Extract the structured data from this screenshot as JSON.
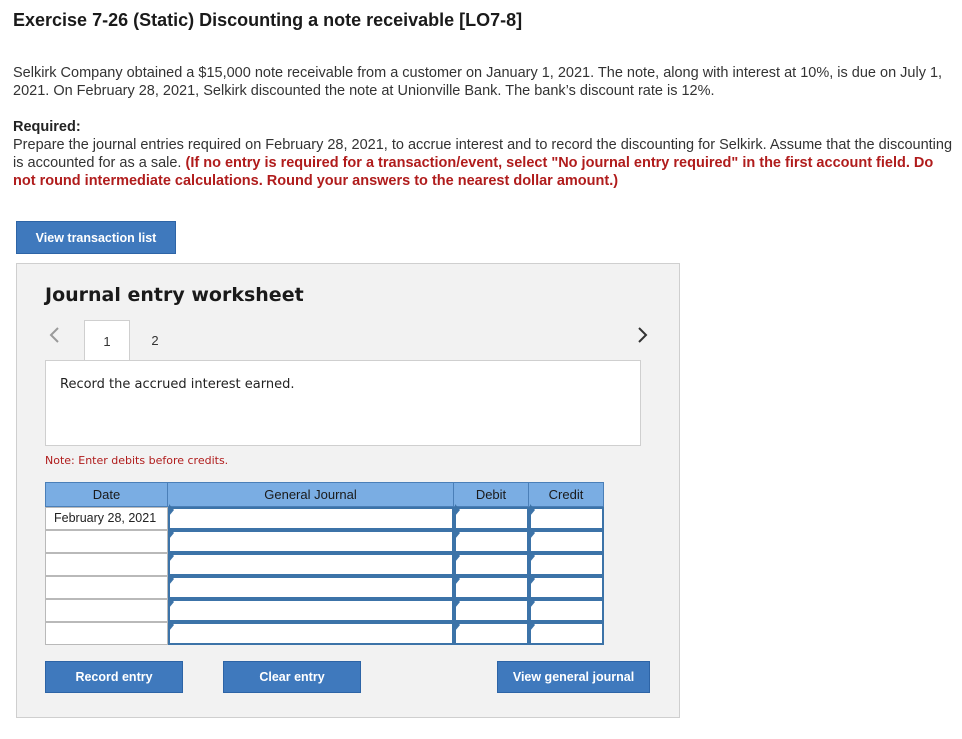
{
  "page": {
    "title": "Exercise 7-26 (Static) Discounting a note receivable [LO7-8]",
    "problem_text": "Selkirk Company obtained a $15,000 note receivable from a customer on January 1, 2021. The note, along with interest at 10%, is due on July 1, 2021. On February 28, 2021, Selkirk discounted the note at Unionville Bank. The bank’s discount rate is 12%.",
    "required_label": "Required:",
    "required_text": "Prepare the journal entries required on February 28, 2021, to accrue interest and to record the discounting for Selkirk. Assume that the discounting is accounted for as a sale.",
    "required_instructions": "(If no entry is required for a transaction/event, select \"No journal entry required\" in the first account field. Do not round intermediate calculations. Round your answers to the nearest dollar amount.)"
  },
  "buttons": {
    "view_transaction_list": "View transaction list",
    "record_entry": "Record entry",
    "clear_entry": "Clear entry",
    "view_general_journal": "View general journal"
  },
  "worksheet": {
    "title": "Journal entry worksheet",
    "tabs": [
      "1",
      "2"
    ],
    "active_tab": "1",
    "prev_icon": "chevron-left-icon",
    "next_icon": "chevron-right-icon",
    "description": "Record the accrued interest earned.",
    "note": "Note: Enter debits before credits.",
    "table": {
      "headers": [
        "Date",
        "General Journal",
        "Debit",
        "Credit"
      ],
      "rows": [
        {
          "date": "February 28, 2021",
          "account": "",
          "debit": "",
          "credit": ""
        },
        {
          "date": "",
          "account": "",
          "debit": "",
          "credit": ""
        },
        {
          "date": "",
          "account": "",
          "debit": "",
          "credit": ""
        },
        {
          "date": "",
          "account": "",
          "debit": "",
          "credit": ""
        },
        {
          "date": "",
          "account": "",
          "debit": "",
          "credit": ""
        },
        {
          "date": "",
          "account": "",
          "debit": "",
          "credit": ""
        }
      ]
    }
  },
  "colors": {
    "button_blue": "#3f79bd",
    "header_blue": "#7aade3",
    "input_border": "#3c73a8",
    "instruction_red": "#b01c1c"
  }
}
